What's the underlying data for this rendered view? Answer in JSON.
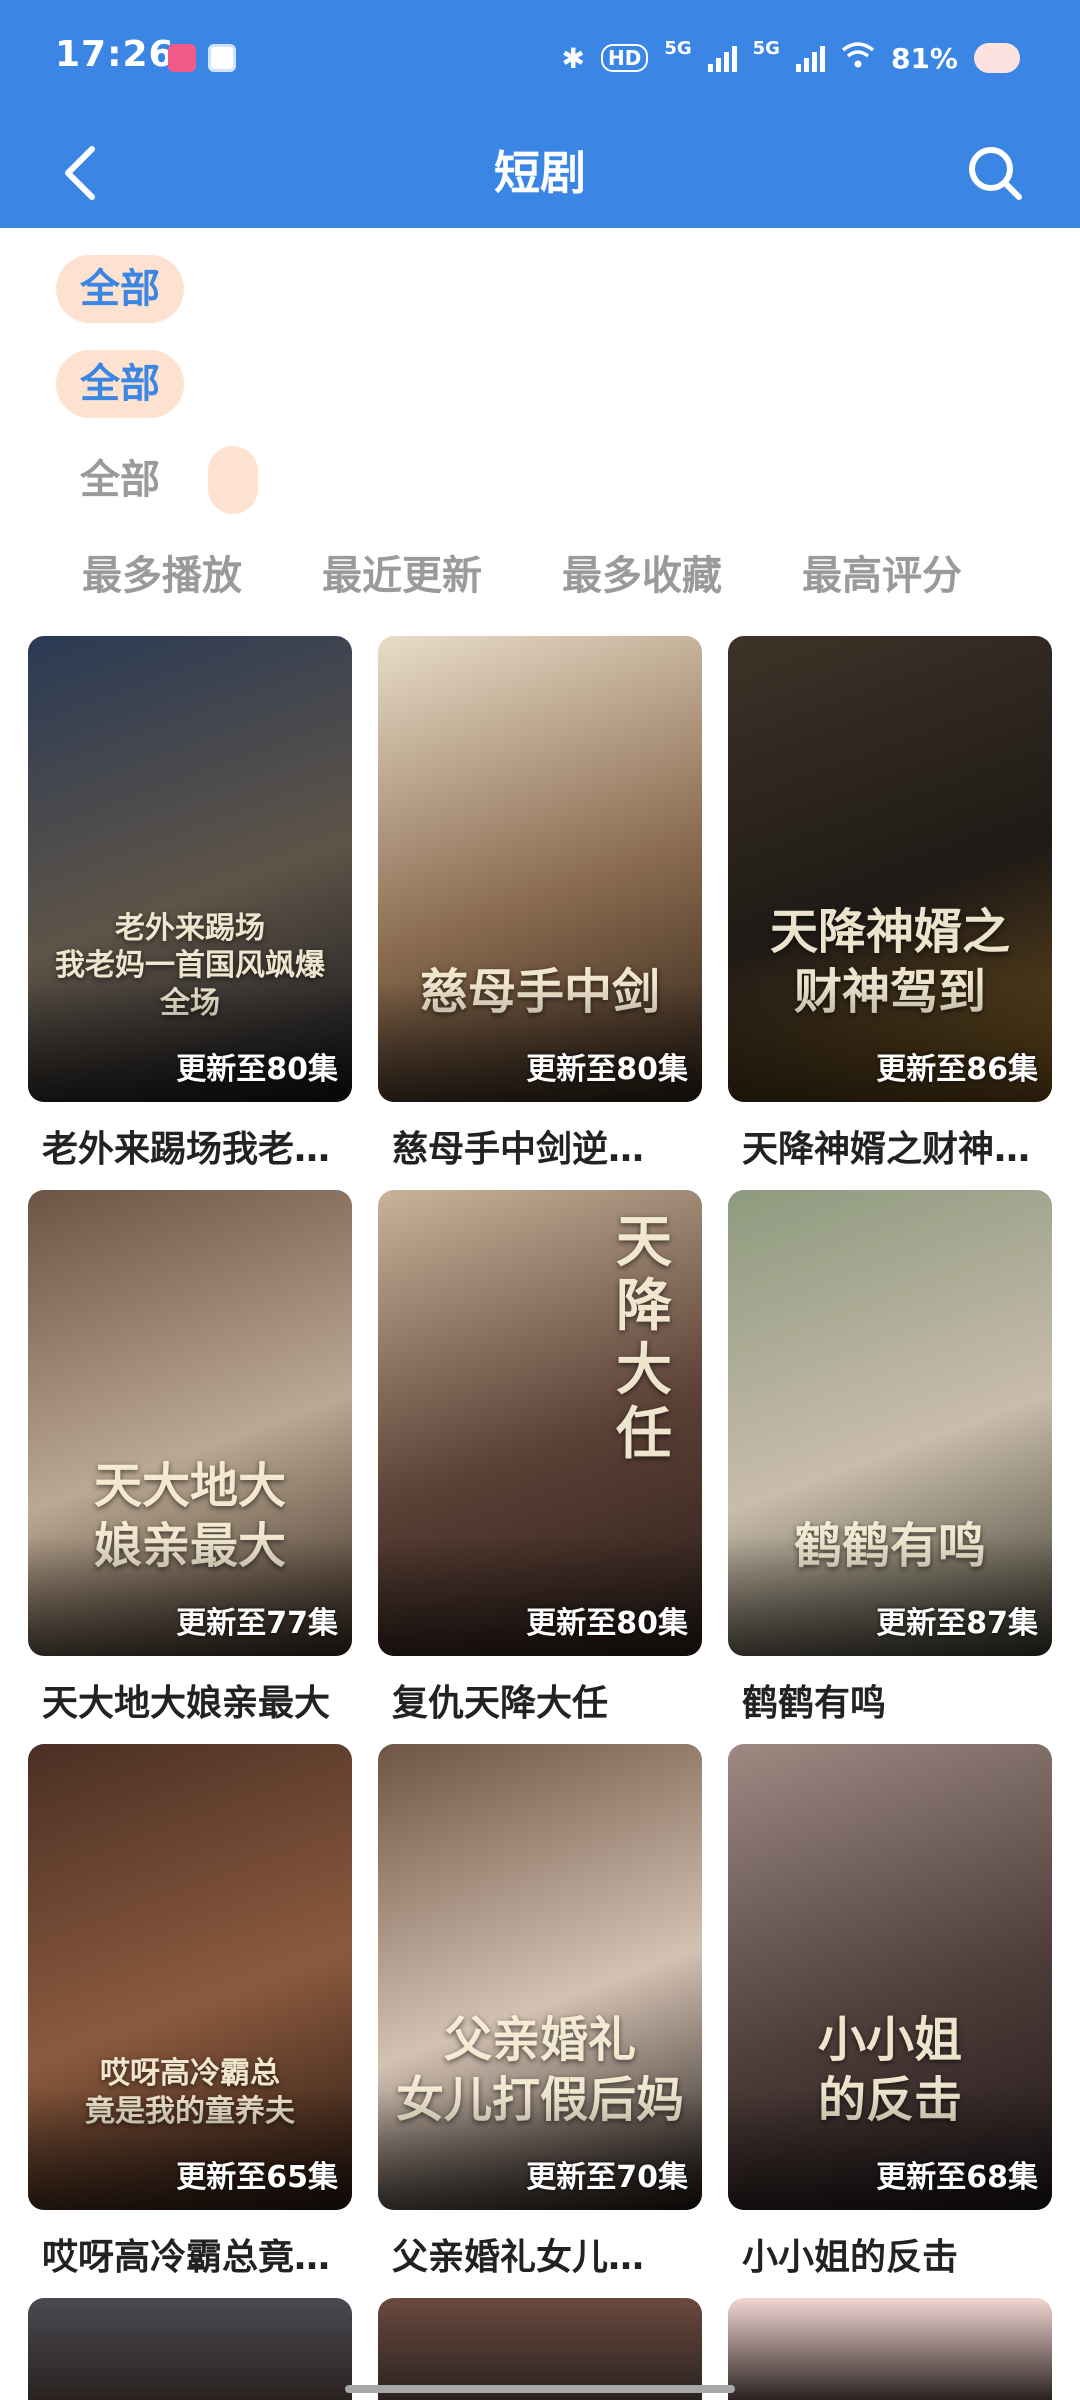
{
  "status_bar": {
    "time": "17:26",
    "network1": "5G",
    "network2": "5G",
    "battery": "81%"
  },
  "nav": {
    "title": "短剧"
  },
  "filters": {
    "row1": [
      "全部"
    ],
    "row2": [
      "全部"
    ],
    "row3": [
      "全部",
      ""
    ]
  },
  "sort": [
    "最多播放",
    "最近更新",
    "最多收藏",
    "最高评分"
  ],
  "dramas": [
    {
      "title": "老外来踢场我老…",
      "badge": "更新至80集",
      "poster_text": "老外来踢场\n我老妈一首国风飒爆全场",
      "colors": [
        "#2a3a55",
        "#5e5448",
        "#121318"
      ]
    },
    {
      "title": "慈母手中剑逆…",
      "badge": "更新至80集",
      "poster_text": "慈母手中剑",
      "colors": [
        "#e9ddc9",
        "#8a6b4f",
        "#2d2016"
      ]
    },
    {
      "title": "天降神婿之财神…",
      "badge": "更新至86集",
      "poster_text": "天降神婿之\n财神驾到",
      "colors": [
        "#3d3328",
        "#1f1a16",
        "#6b4d1c"
      ]
    },
    {
      "title": "天大地大娘亲最大",
      "badge": "更新至77集",
      "poster_text": "天大地大\n娘亲最大",
      "colors": [
        "#6b5443",
        "#bba892",
        "#3a2c22"
      ]
    },
    {
      "title": "复仇天降大任",
      "badge": "更新至80集",
      "poster_text": "天\n降\n大\n任",
      "colors": [
        "#c9b49a",
        "#5a4035",
        "#2b1d19"
      ]
    },
    {
      "title": "鹤鹤有鸣",
      "badge": "更新至87集",
      "poster_text": "鹤鹤有鸣",
      "colors": [
        "#8d9a7e",
        "#c8bcaa",
        "#3d3a2e"
      ]
    },
    {
      "title": "哎呀高冷霸总竟…",
      "badge": "更新至65集",
      "poster_text": "哎呀高冷霸总\n竟是我的童养夫",
      "colors": [
        "#4b2f24",
        "#8b5a3e",
        "#26160f"
      ]
    },
    {
      "title": "父亲婚礼女儿…",
      "badge": "更新至70集",
      "poster_text": "父亲婚礼\n女儿打假后妈",
      "colors": [
        "#6e5544",
        "#d3c1b2",
        "#1c1512"
      ]
    },
    {
      "title": "小小姐的反击",
      "badge": "更新至68集",
      "poster_text": "小小姐\n的反击",
      "colors": [
        "#9d8a83",
        "#4f3e3a",
        "#1e1618"
      ]
    }
  ],
  "next_row_colors": [
    "#4a4a52",
    "#6a4a3e",
    "#f2d6d2"
  ]
}
